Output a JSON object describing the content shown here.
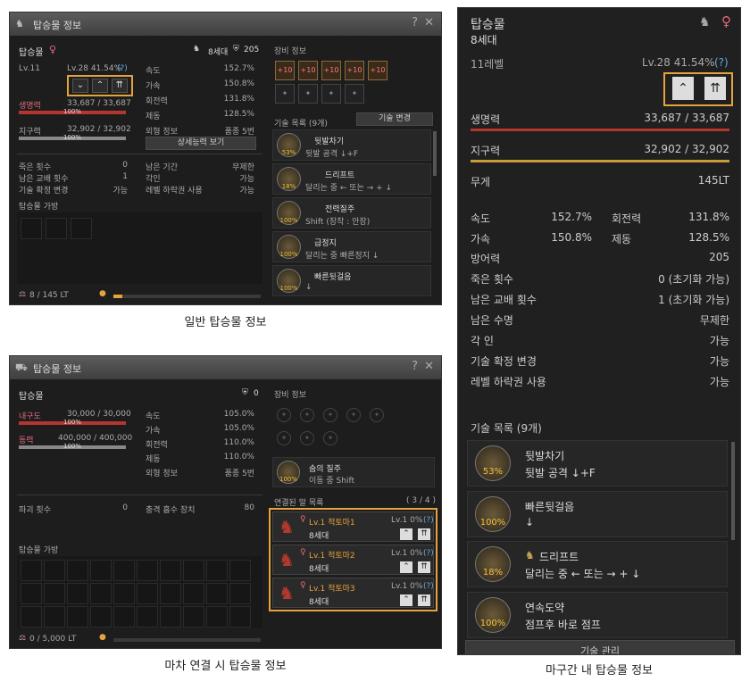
{
  "p1": {
    "caption": "일반 탑승물 정보",
    "title": "탑승물 정보",
    "help": "?",
    "close": "✕",
    "mount": "탑승물",
    "gen": "8세대",
    "armor": "205",
    "lvl": "Lv.11",
    "lvlexp": "Lv.28 41.54%",
    "q": "(?)",
    "hp_label": "생명력",
    "hp": "33,687 / 33,687",
    "hp_pct": "100%",
    "st_label": "지구력",
    "st": "32,902 / 32,902",
    "st_pct": "100%",
    "stats": [
      [
        "속도",
        "152.7%"
      ],
      [
        "가속",
        "150.8%"
      ],
      [
        "회전력",
        "131.8%"
      ],
      [
        "제동",
        "128.5%"
      ],
      [
        "외형 정보",
        "품종 5번"
      ]
    ],
    "detail_btn": "상세능력 보기",
    "left2": [
      [
        "죽은 횟수",
        "0"
      ],
      [
        "남은 교배 횟수",
        "1"
      ],
      [
        "기술 확정 변경",
        "가능"
      ]
    ],
    "right2": [
      [
        "남은 기간",
        "무제한"
      ],
      [
        "각인",
        "가능"
      ],
      [
        "레벨 하락권 사용",
        "가능"
      ]
    ],
    "bag": "탑승물 가방",
    "weight": "8 / 145 LT",
    "equip": "장비 정보",
    "eq": [
      "+10",
      "+10",
      "+10",
      "+10",
      "+10"
    ],
    "skills_label": "기술 목록 (9개)",
    "skill_btn": "기술 변경",
    "skills": [
      {
        "name": "뒷발차기",
        "desc": "뒷발 공격 ↓+F",
        "pct": "53%"
      },
      {
        "name": "드리프트",
        "desc": "달리는 중 ← 또는 → + ↓",
        "pct": "18%"
      },
      {
        "name": "전력질주",
        "desc": "Shift (장착 : 안장)",
        "pct": "100%"
      },
      {
        "name": "급정지",
        "desc": "달리는 중 빠른정지 ↓",
        "pct": "100%"
      },
      {
        "name": "빠른뒷걸음",
        "desc": "↓",
        "pct": "100%"
      }
    ]
  },
  "p2": {
    "caption": "마차 연결 시 탑승물 정보",
    "title": "탑승물 정보",
    "help": "?",
    "close": "✕",
    "mount": "탑승물",
    "armor": "0",
    "dur_label": "내구도",
    "dur": "30,000 / 30,000",
    "dur_pct": "100%",
    "pow_label": "동력",
    "pow": "400,000 / 400,000",
    "pow_pct": "100%",
    "stats": [
      [
        "속도",
        "105.0%"
      ],
      [
        "가속",
        "105.0%"
      ],
      [
        "회전력",
        "110.0%"
      ],
      [
        "제동",
        "110.0%"
      ],
      [
        "외형 정보",
        "품종 5번"
      ]
    ],
    "destroy": "파괴 횟수",
    "destroy_v": "0",
    "shock": "충격 흡수 장치",
    "shock_v": "80",
    "bag": "탑승물 가방",
    "weight": "0 / 5,000 LT",
    "equip": "장비 정보",
    "skill": {
      "name": "숨의 질주",
      "desc": "이동 중 Shift",
      "pct": "100%"
    },
    "linked_label": "연결된 말 목록",
    "linked_count": "( 3 / 4 )",
    "horses": [
      {
        "name": "Lv.1 적토마1",
        "gen": "8세대",
        "lv": "Lv.1 0%"
      },
      {
        "name": "Lv.1 적토마2",
        "gen": "8세대",
        "lv": "Lv.1 0%"
      },
      {
        "name": "Lv.1 적토마3",
        "gen": "8세대",
        "lv": "Lv.1 0%"
      }
    ]
  },
  "p3": {
    "caption": "마구간 내 탑승물 정보",
    "mount": "탑승물",
    "gen": "8세대",
    "lvl": "11레벨",
    "lvlexp": "Lv.28 41.54%",
    "q": "(?)",
    "hp_label": "생명력",
    "hp": "33,687 / 33,687",
    "st_label": "지구력",
    "st": "32,902 / 32,902",
    "wt_label": "무게",
    "wt": "145LT",
    "speed": "속도",
    "speed_v": "152.7%",
    "turn": "회전력",
    "turn_v": "131.8%",
    "acc": "가속",
    "acc_v": "150.8%",
    "brake": "제동",
    "brake_v": "128.5%",
    "rows": [
      [
        "방어력",
        "205"
      ],
      [
        "죽은 횟수",
        "0 (초기화 가능)"
      ],
      [
        "남은 교배 횟수",
        "1 (초기화 가능)"
      ],
      [
        "남은 수명",
        "무제한"
      ],
      [
        "각 인",
        "가능"
      ],
      [
        "기술 확정 변경",
        "가능"
      ],
      [
        "레벨 하락권 사용",
        "가능"
      ]
    ],
    "skills_label": "기술 목록 (9개)",
    "skills": [
      {
        "name": "뒷발차기",
        "desc": "뒷발 공격 ↓+F",
        "pct": "53%"
      },
      {
        "name": "빠른뒷걸음",
        "desc": "↓",
        "pct": "100%"
      },
      {
        "name": "드리프트",
        "desc": "달리는 중 ← 또는 → + ↓",
        "pct": "18%"
      },
      {
        "name": "연속도약",
        "desc": "점프후 바로 점프",
        "pct": "100%"
      }
    ],
    "manage_btn": "기술 관리"
  }
}
